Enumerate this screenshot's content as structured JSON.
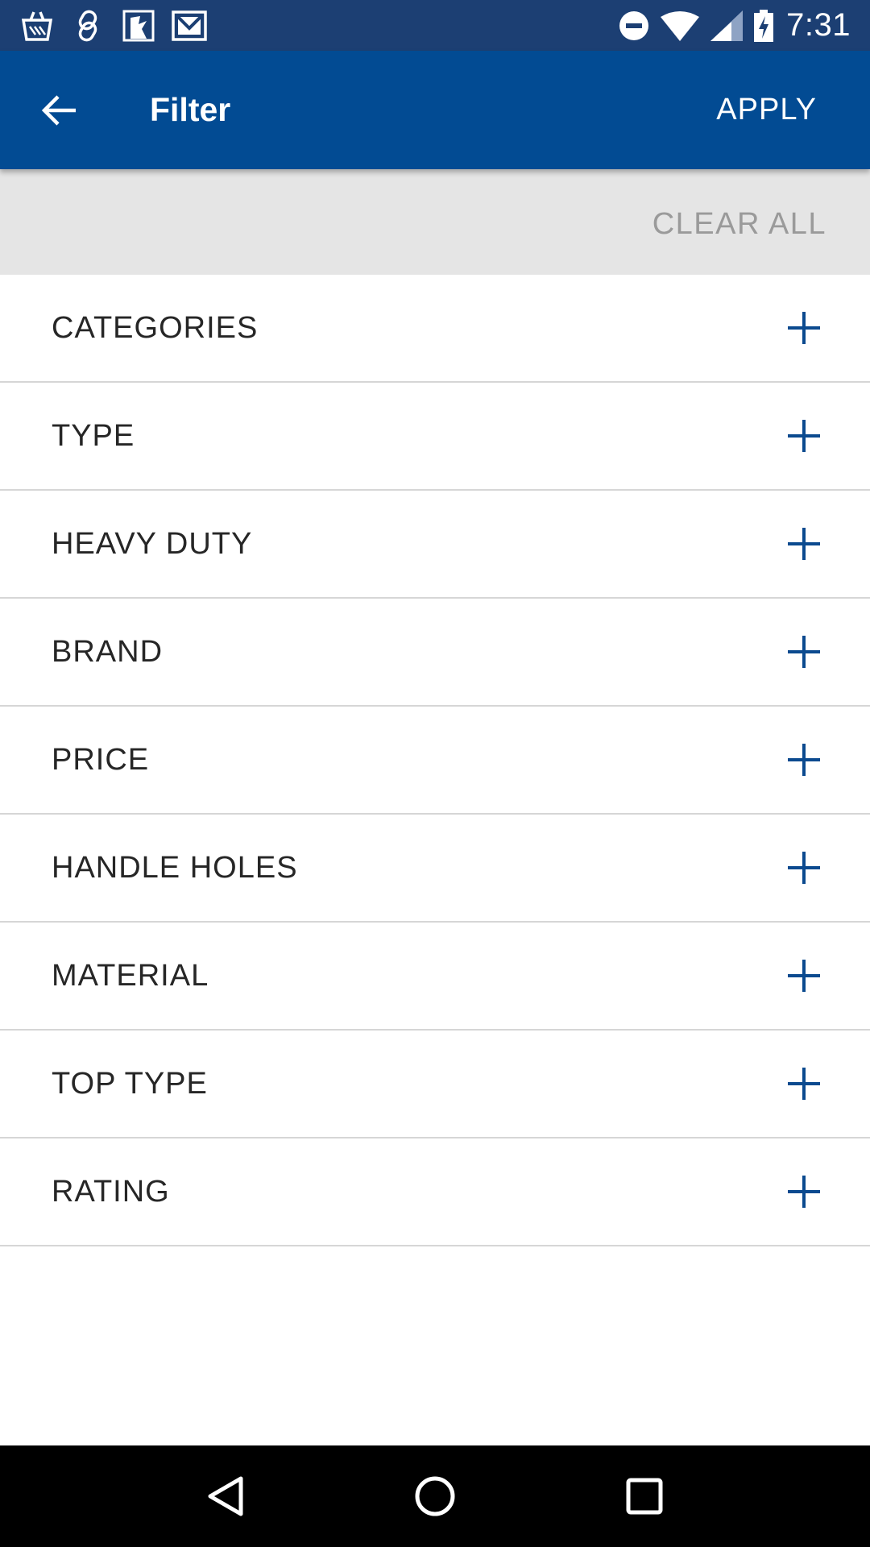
{
  "status_bar": {
    "time": "7:31",
    "left_icons": [
      "store-icon",
      "link-icon",
      "image-icon",
      "mail-icon"
    ],
    "right_icons": [
      "do-not-disturb-icon",
      "wifi-icon",
      "signal-icon",
      "battery-charging-icon"
    ]
  },
  "app_bar": {
    "title": "Filter",
    "apply_label": "APPLY",
    "background": "#024b93"
  },
  "clear_all_label": "CLEAR ALL",
  "filters": [
    {
      "label": "CATEGORIES"
    },
    {
      "label": "TYPE"
    },
    {
      "label": "HEAVY DUTY"
    },
    {
      "label": "BRAND"
    },
    {
      "label": "PRICE"
    },
    {
      "label": "HANDLE HOLES"
    },
    {
      "label": "MATERIAL"
    },
    {
      "label": "TOP TYPE"
    },
    {
      "label": "RATING"
    }
  ],
  "colors": {
    "accent": "#0b4a8f",
    "status_bar": "#1c3f73",
    "clear_bar": "#e5e5e5"
  }
}
